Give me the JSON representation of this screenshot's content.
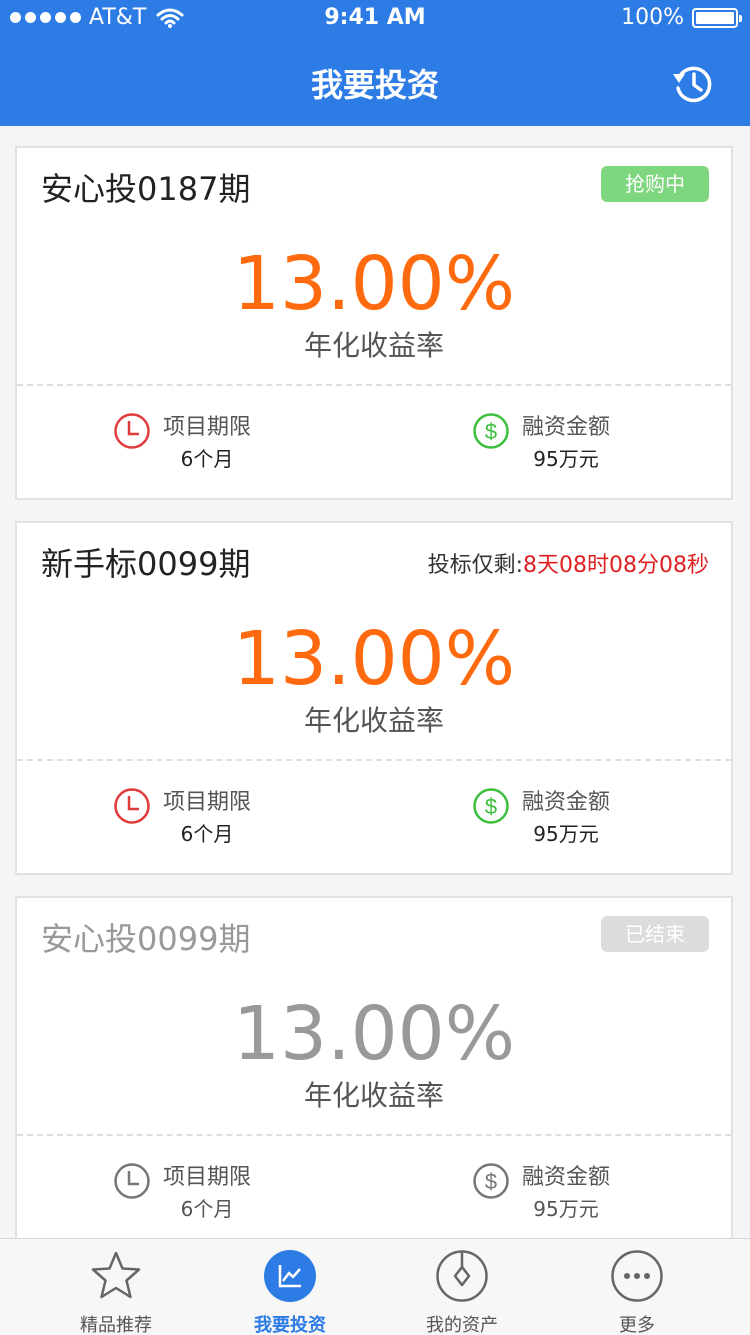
{
  "status_bar": {
    "carrier": "AT&T",
    "time": "9:41 AM",
    "battery": "100%"
  },
  "header": {
    "title": "我要投资",
    "history_icon": "history-icon"
  },
  "cards": [
    {
      "name": "安心投0187期",
      "status": "抢购中",
      "rate": "13.00%",
      "rate_label": "年化收益率",
      "term_label": "项目期限",
      "term_value": "6个月",
      "amount_label": "融资金额",
      "amount_value": "95万元"
    },
    {
      "name": "新手标0099期",
      "countdown_label": "投标仅剩:",
      "countdown_value": "8天08时08分08秒",
      "rate": "13.00%",
      "rate_label": "年化收益率",
      "term_label": "项目期限",
      "term_value": "6个月",
      "amount_label": "融资金额",
      "amount_value": "95万元"
    },
    {
      "name": "安心投0099期",
      "status": "已结束",
      "rate": "13.00%",
      "rate_label": "年化收益率",
      "term_label": "项目期限",
      "term_value": "6个月",
      "amount_label": "融资金额",
      "amount_value": "95万元"
    }
  ],
  "tabbar": {
    "items": [
      {
        "label": "精品推荐",
        "icon": "star-icon"
      },
      {
        "label": "我要投资",
        "icon": "chart-icon",
        "active": true
      },
      {
        "label": "我的资产",
        "icon": "asset-icon"
      },
      {
        "label": "更多",
        "icon": "more-icon"
      }
    ]
  },
  "colors": {
    "brand": "#2d7be5",
    "rate": "#ff6a0f",
    "active_badge": "#7ed67e",
    "countdown": "#e02020",
    "clock_icon": "#e03a3a",
    "money_icon": "#3cbf3c"
  }
}
